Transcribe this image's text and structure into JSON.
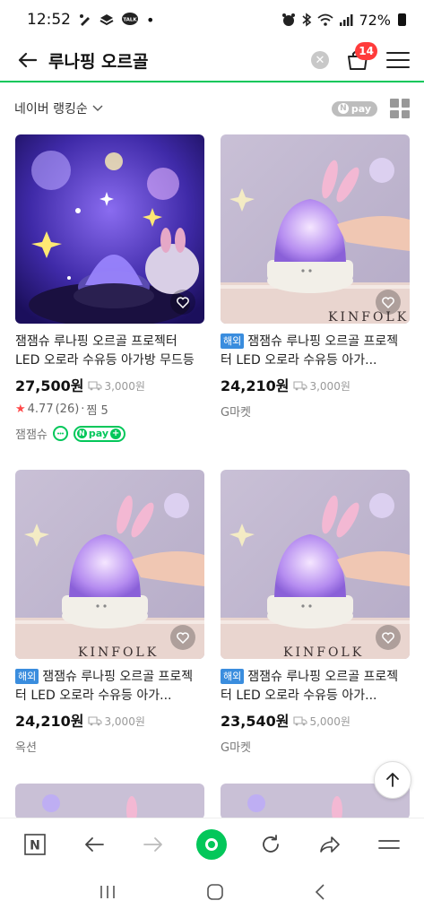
{
  "status_bar": {
    "time": "12:52",
    "notification_icons": [
      "pen-icon",
      "layers-icon",
      "talk-icon"
    ],
    "talk_label": "TALK",
    "dot": "•",
    "right_icons": [
      "alarm-icon",
      "bluetooth-icon",
      "wifi-icon",
      "signal-icon"
    ],
    "battery": "72%"
  },
  "header": {
    "query": "루나핑 오르골",
    "clear_symbol": "✕",
    "cart_count": "14"
  },
  "sort": {
    "label": "네이버 랭킹순",
    "npay_filter": "pay",
    "npay_n": "N"
  },
  "products": [
    {
      "title": "잼잼슈 루나핑 오르골 프로젝터 LED 오로라 수유등 아가방 무드등",
      "overseas": "",
      "price": "27,500원",
      "shipping": "3,000원",
      "rating": "4.77",
      "reviews": "(26)",
      "favorites": "찜 5",
      "seller": "잼잼슈",
      "npay": "pay",
      "image": "kids-room"
    },
    {
      "title": "잼잼슈 루나핑 오르골 프로젝터 LED 오로라 수유등 아가...",
      "overseas": "해외",
      "price": "24,210원",
      "shipping": "3,000원",
      "seller": "G마켓",
      "image": "hand-lamp"
    },
    {
      "title": "잼잼슈 루나핑 오르골 프로젝터 LED 오로라 수유등 아가...",
      "overseas": "해외",
      "price": "24,210원",
      "shipping": "3,000원",
      "seller": "옥션",
      "image": "hand-lamp"
    },
    {
      "title": "잼잼슈 루나핑 오르골 프로젝터 LED 오로라 수유등 아가...",
      "overseas": "해외",
      "price": "23,540원",
      "shipping": "5,000원",
      "seller": "G마켓",
      "image": "hand-lamp"
    }
  ],
  "book_text": "KINFOLK",
  "toolbar": {
    "items": [
      "naver-home-icon",
      "back-icon",
      "forward-icon",
      "green-dot-icon",
      "refresh-icon",
      "share-icon",
      "menu-icon"
    ],
    "home_letter": "N"
  },
  "nav": {
    "items": [
      "recent-apps-icon",
      "home-icon",
      "back-icon"
    ]
  },
  "colors": {
    "accent": "#03c75a",
    "badge": "#ff3b3b",
    "overseas": "#3a8dde",
    "star": "#ff4a4a"
  }
}
